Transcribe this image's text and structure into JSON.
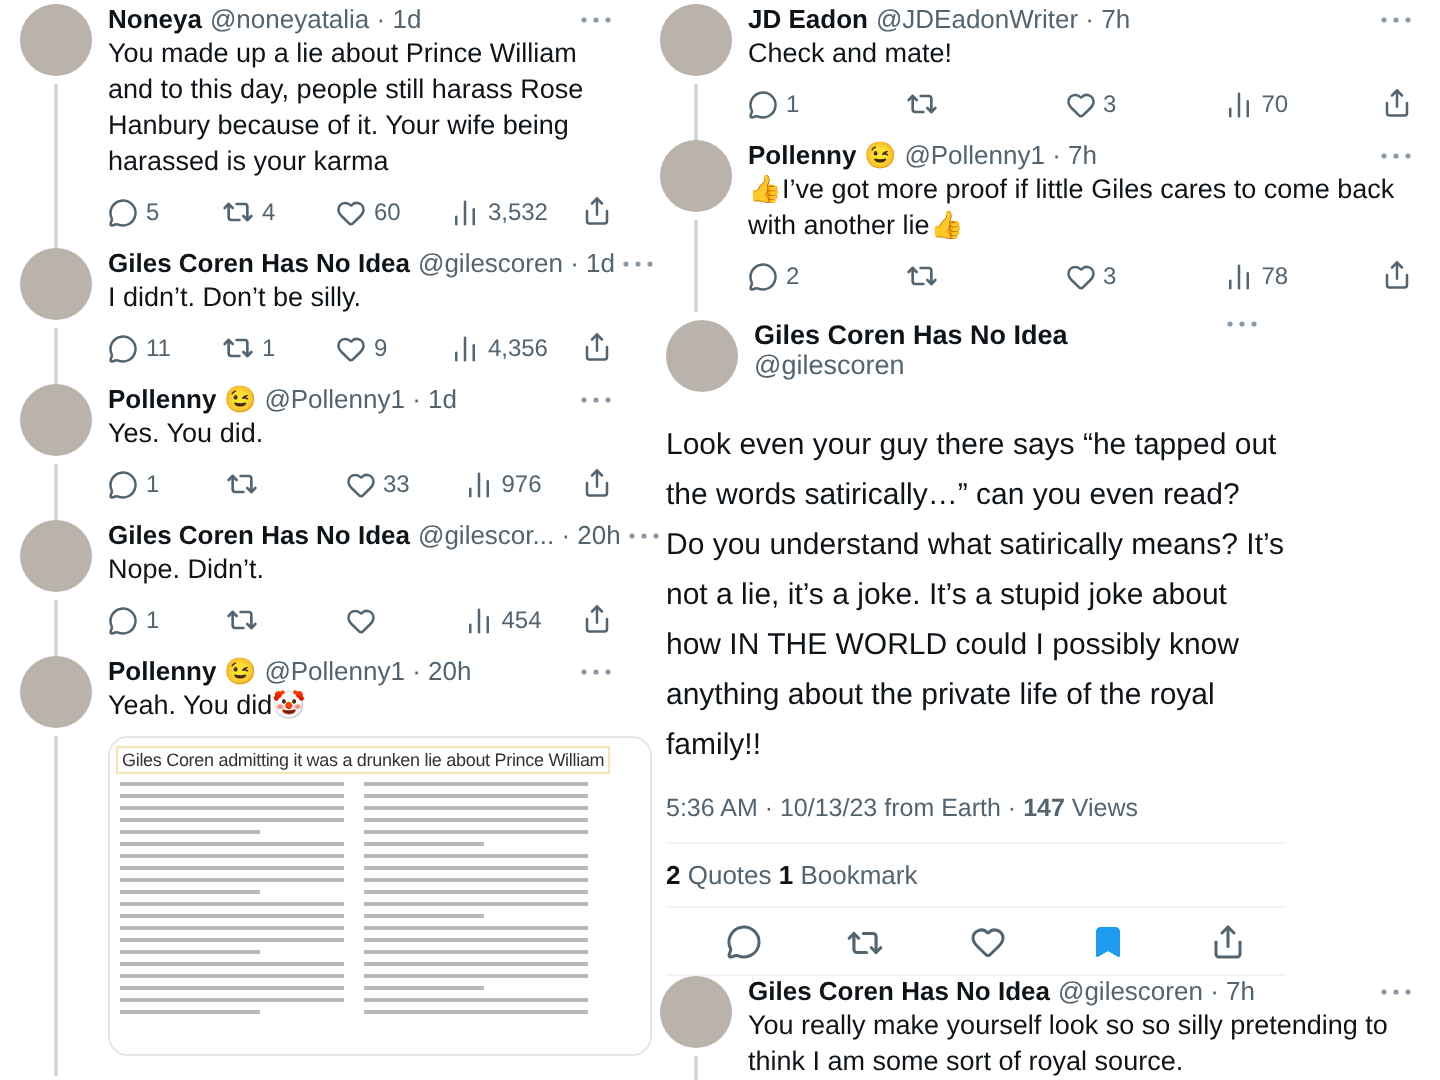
{
  "left_thread": [
    {
      "name": "Noneya",
      "handle": "@noneyatalia · 1d",
      "text": "You made up a lie about Prince William and to this day, people still harass Rose Hanbury because of it. Your wife being harassed is your karma",
      "stats": {
        "replies": "5",
        "retweets": "4",
        "likes": "60",
        "views": "3,532"
      }
    },
    {
      "name": "Giles Coren Has No Idea",
      "handle": "@gilescoren · 1d",
      "text": "I didn’t. Don’t be silly.",
      "stats": {
        "replies": "11",
        "retweets": "1",
        "likes": "9",
        "views": "4,356"
      }
    },
    {
      "name": "Pollenny",
      "emoji": "😉",
      "handle": "@Pollenny1 · 1d",
      "text": "Yes. You did.",
      "stats": {
        "replies": "1",
        "likes": "33",
        "views": "976"
      }
    },
    {
      "name": "Giles Coren Has No Idea",
      "handle": "@gilescor... · 20h",
      "text": "Nope. Didn’t.",
      "stats": {
        "replies": "1",
        "views": "454"
      }
    },
    {
      "name": "Pollenny",
      "emoji": "😉",
      "handle": "@Pollenny1 · 20h",
      "text": "Yeah. You did🤡",
      "attachment": {
        "heading": "Giles Coren admitting it was a drunken lie about Prince William"
      }
    }
  ],
  "right_thread": [
    {
      "name": "JD Eadon",
      "handle": "@JDEadonWriter · 7h",
      "text": "Check and mate!",
      "stats": {
        "replies": "1",
        "likes": "3",
        "views": "70"
      }
    },
    {
      "name": "Pollenny",
      "emoji": "😉",
      "handle": "@Pollenny1 · 7h",
      "text": "👍I’ve got more proof if little Giles cares to come back with another lie👍",
      "stats": {
        "replies": "2",
        "likes": "3",
        "views": "78"
      }
    }
  ],
  "main_tweet": {
    "name": "Giles Coren Has No Idea",
    "handle": "@gilescoren",
    "text": "Look even your guy there says “he tapped out the words satirically…” can you even read? Do you understand what satirically means? It’s not a lie, it’s a joke. It’s a stupid joke about how IN THE WORLD could I possibly know anything about the private life of the royal family!!",
    "meta": "5:36 AM · 10/13/23 from Earth · **147** Views",
    "engagement": "**2** Quotes **1** Bookmark",
    "bookmarked": true
  },
  "reply": {
    "name": "Giles Coren Has No Idea",
    "handle": "@gilescoren · 7h",
    "text": "You really make yourself look so so silly pretending to think I am some sort of royal source."
  }
}
